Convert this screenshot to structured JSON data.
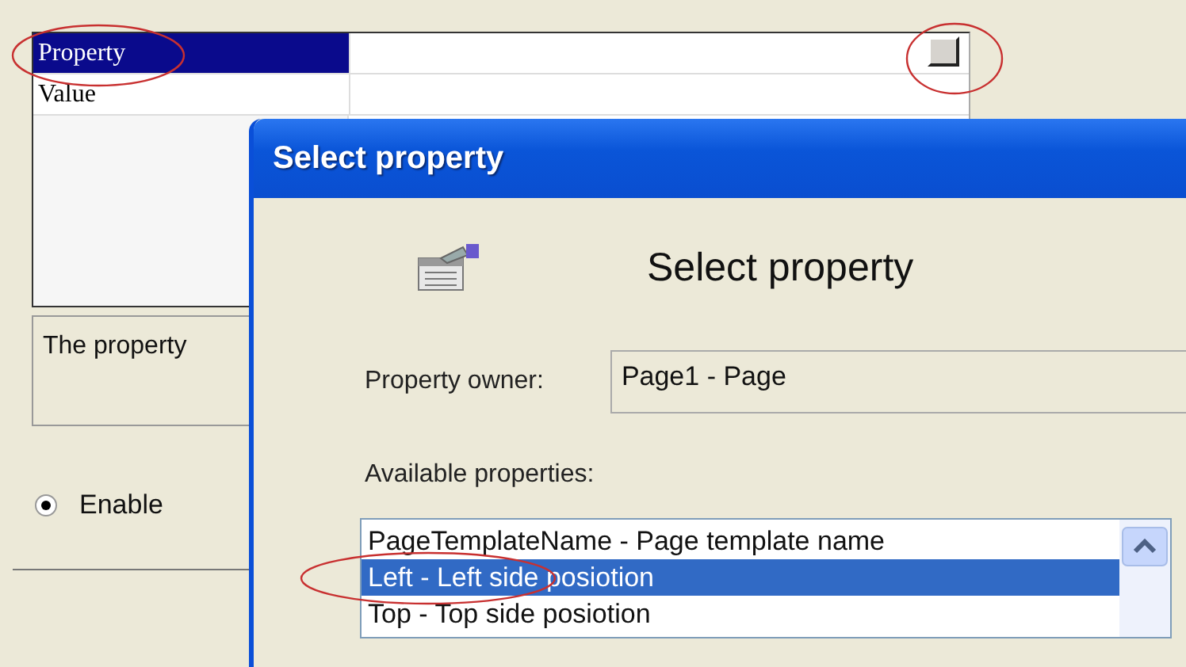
{
  "property_grid": {
    "rows": [
      {
        "label": "Property",
        "selected": true
      },
      {
        "label": "Value",
        "selected": false
      }
    ]
  },
  "description": {
    "text": "The property"
  },
  "enable_radio": {
    "label": "Enable",
    "checked": true
  },
  "dialog": {
    "title": "Select property",
    "heading": "Select property",
    "owner_label": "Property owner:",
    "owner_value": "Page1 - Page",
    "available_label": "Available properties:",
    "items": [
      {
        "label": "PageTemplateName - Page template name",
        "selected": false
      },
      {
        "label": "Left - Left side posiotion",
        "selected": true
      },
      {
        "label": "Top - Top side posiotion",
        "selected": false
      }
    ]
  }
}
